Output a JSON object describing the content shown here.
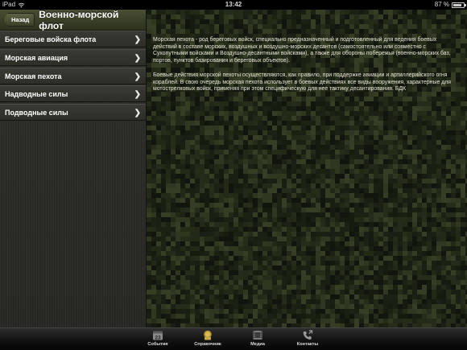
{
  "status_bar": {
    "carrier": "iPad",
    "time": "13:42",
    "battery": "87 %",
    "battery_level": 0.87
  },
  "navbar": {
    "back_label": "Назад",
    "title": "Военно-морской флот"
  },
  "menu": {
    "items": [
      {
        "label": "Береговые войска флота"
      },
      {
        "label": "Морская авиация"
      },
      {
        "label": "Морская пехота"
      },
      {
        "label": "Надводные силы"
      },
      {
        "label": "Подводные силы"
      }
    ]
  },
  "content": {
    "paragraphs": [
      "Морская пехота -  род береговых войск, специально предназначенный и подготовленный для ведения боевых действий в составе морских, воздушных и воздушно-морских десантов (самостоятельно или совместно с Сухопутными войсками и Воздушно-десантными войсками), а также для обороны побережья (военно-морских баз, портов, пунктов базирования и береговых объектов).",
      "Боевые действия морской пехоты осуществляются, как правило, при поддержке авиации и артиллерийского огня кораблей. В свою очередь морская пехота использует в боевых действиях все виды вооружения, характерные для мотострелковых войск, применяя при этом специфическую для нее тактику десантирования. БДК"
    ]
  },
  "tabbar": {
    "tabs": [
      {
        "label": "События",
        "icon": "calendar-icon",
        "date": "23"
      },
      {
        "label": "Справочник",
        "icon": "handbook-icon"
      },
      {
        "label": "Медиа",
        "icon": "film-icon"
      },
      {
        "label": "Контакты",
        "icon": "phone-icon"
      }
    ]
  }
}
